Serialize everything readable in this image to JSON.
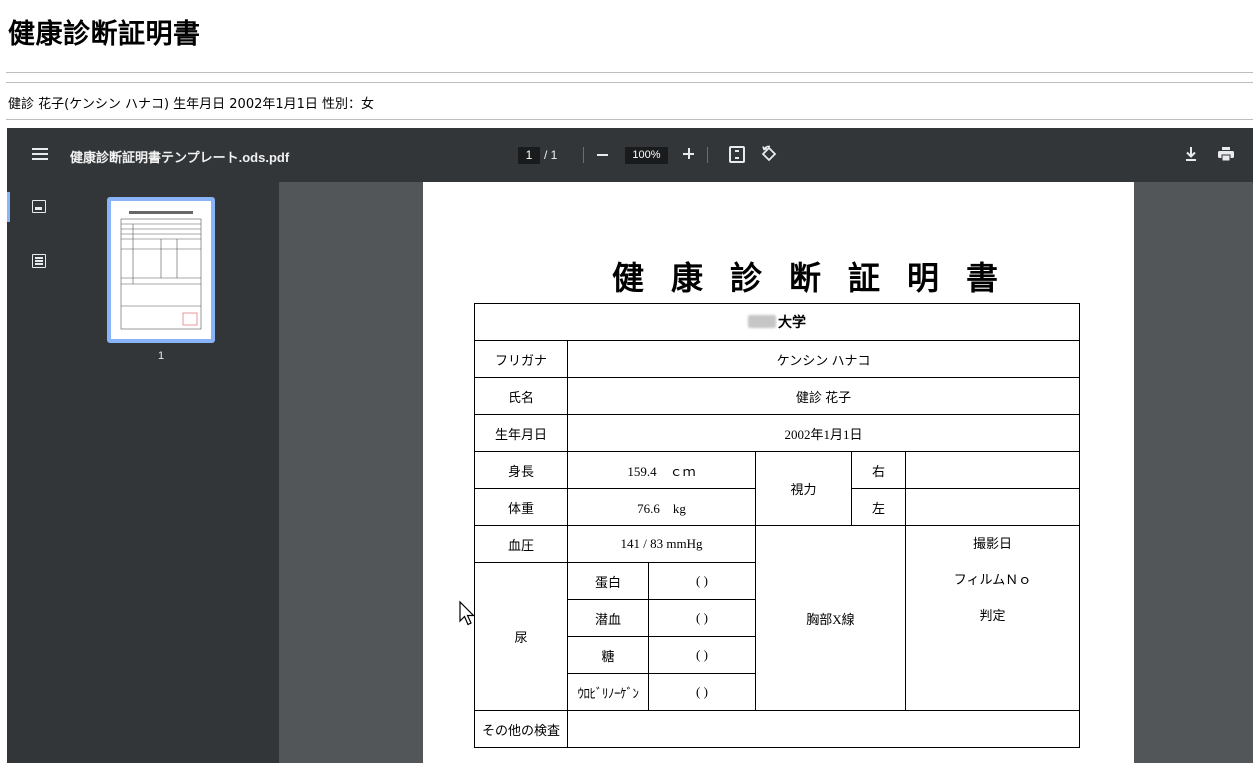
{
  "page": {
    "title": "健康診断証明書",
    "patient_line": "健診 花子(ケンシン ハナコ) 生年月日 2002年1月1日 性別：女"
  },
  "viewer": {
    "filename": "健康診断証明書テンプレート.ods.pdf",
    "page_current": "1",
    "page_total": "/ 1",
    "zoom": "100%",
    "thumbnail_label": "1"
  },
  "certificate": {
    "title": "健康診断証明書",
    "university": "大学",
    "rows": {
      "furigana_label": "フリガナ",
      "furigana_value": "ケンシン ハナコ",
      "name_label": "氏名",
      "name_value": "健診 花子",
      "dob_label": "生年月日",
      "dob_value": "2002年1月1日",
      "height_label": "身長",
      "height_value": "159.4　ｃｍ",
      "weight_label": "体重",
      "weight_value": "76.6　kg",
      "vision_label": "視力",
      "vision_right": "右",
      "vision_left": "左",
      "bp_label": "血圧",
      "bp_value": "141 / 83 mmHg",
      "urine_label": "尿",
      "protein_label": "蛋白",
      "occult_blood_label": "潜血",
      "sugar_label": "糖",
      "urobilinogen_label": "ｳﾛﾋﾞﾘﾉｰｹﾞﾝ",
      "paren": "(      )",
      "xray_label": "胸部X線",
      "xray_date": "撮影日",
      "xray_film": "フィルムＮｏ",
      "xray_judgement": "判定",
      "other_label": "その他の検査"
    }
  }
}
